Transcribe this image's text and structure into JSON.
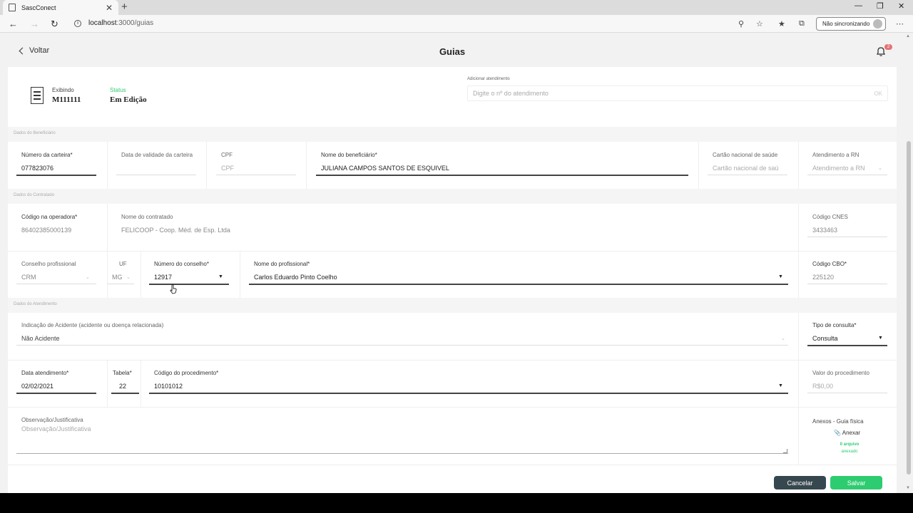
{
  "browser": {
    "tab_title": "SascConect",
    "close_tab": "✕",
    "new_tab": "+",
    "url_host": "localhost",
    "url_path": ":3000/guias",
    "sync_label": "Não sincronizando"
  },
  "header": {
    "back_label": "Voltar",
    "title": "Guias",
    "badge": "2"
  },
  "top": {
    "exibindo_label": "Exibindo",
    "exibindo_value": "M111111",
    "status_label": "Status",
    "status_value": "Em Edição",
    "add_label": "Adicionar atendimento",
    "add_placeholder": "Digite o nº do atendimento",
    "add_ok": "OK"
  },
  "sections": {
    "beneficiario": "Dados do Beneficiário",
    "contratado": "Dados do Contratado",
    "atendimento": "Dados do Atendimento"
  },
  "beneficiario": {
    "carteira_label": "Número da carteira*",
    "carteira_value": "077823076",
    "validade_label": "Data de validade da carteira",
    "cpf_label": "CPF",
    "cpf_placeholder": "CPF",
    "nome_label": "Nome do beneficiário*",
    "nome_value": "JULIANA CAMPOS SANTOS DE ESQUIVEL",
    "cns_label": "Cartão nacional de saúde",
    "cns_placeholder": "Cartão nacional de saú",
    "rn_label": "Atendimento a RN",
    "rn_placeholder": "Atendimento a RN"
  },
  "contratado": {
    "codigo_label": "Código na operadora*",
    "codigo_value": "86402385000139",
    "nome_label": "Nome do contratado",
    "nome_value": "FELICOOP - Coop. Méd. de Esp. Ltda",
    "cnes_label": "Código CNES",
    "cnes_value": "3433463",
    "conselho_label": "Conselho profissional",
    "conselho_value": "CRM",
    "uf_label": "UF",
    "uf_value": "MG",
    "numero_label": "Número do conselho*",
    "numero_value": "12917",
    "profissional_label": "Nome do profissional*",
    "profissional_value": "Carlos Eduardo Pinto Coelho",
    "cbo_label": "Código CBO*",
    "cbo_value": "225120"
  },
  "atendimento": {
    "acidente_label": "Indicação de Acidente (acidente ou doença relacionada)",
    "acidente_value": "Não Acidente",
    "tipo_label": "Tipo de consulta*",
    "tipo_value": "Consulta",
    "data_label": "Data atendimento*",
    "data_value": "02/02/2021",
    "tabela_label": "Tabela*",
    "tabela_value": "22",
    "procedimento_label": "Código do procedimento*",
    "procedimento_value": "10101012",
    "valor_label": "Valor do procedimento",
    "valor_value": "R$0,00",
    "obs_label": "Observação/Justificativa",
    "obs_placeholder": "Observação/Justificativa",
    "anexos_label": "Anexos - Guia física",
    "anexar_label": "Anexar",
    "arquivos_count": "0 arquivo",
    "arquivos_suffix": "anexado"
  },
  "actions": {
    "cancel": "Cancelar",
    "save": "Salvar"
  },
  "colors": {
    "accent_green": "#2ecc71",
    "dark_button": "#37474f",
    "badge_red": "#e57373"
  }
}
